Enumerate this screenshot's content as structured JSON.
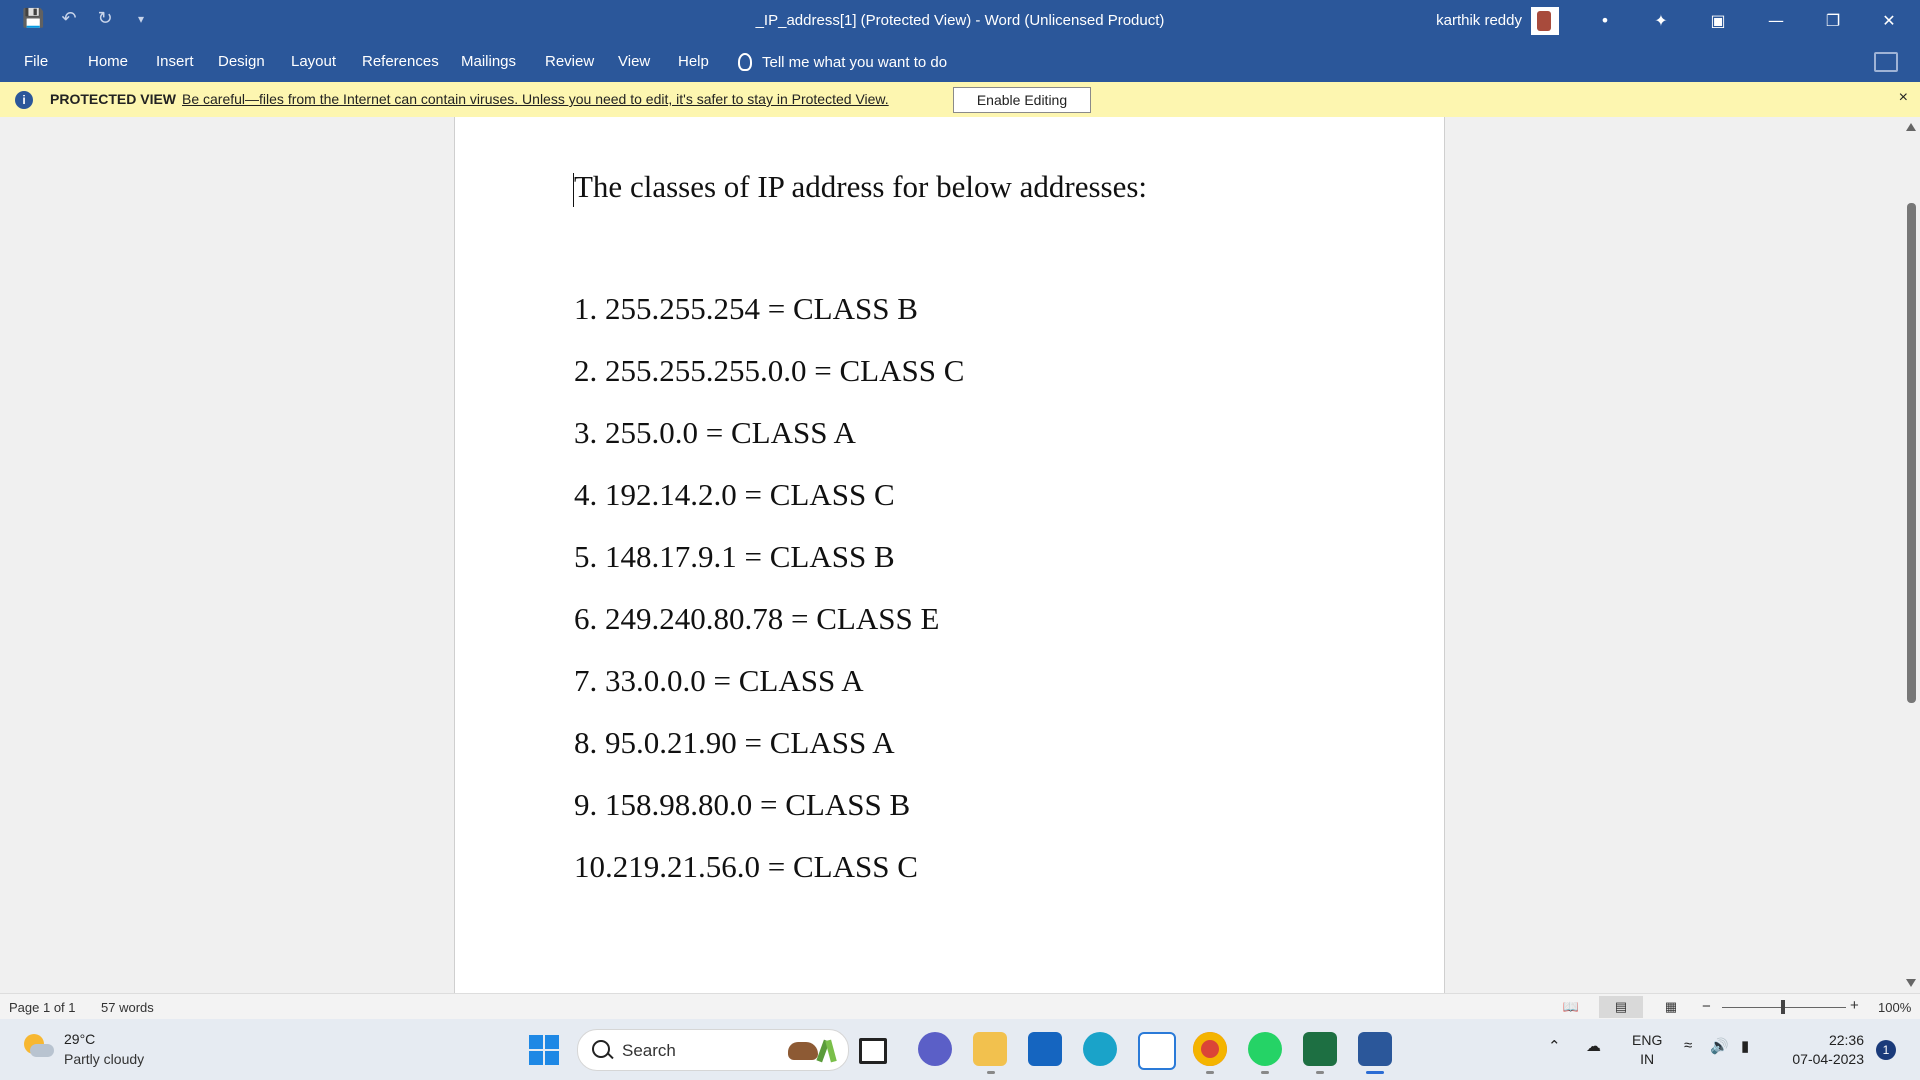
{
  "window": {
    "title": "_IP_address[1] (Protected View)  -  Word (Unlicensed Product)",
    "user": "karthik reddy"
  },
  "qat": {
    "icons": [
      "save-icon",
      "undo-icon",
      "redo-icon",
      "customize-icon"
    ]
  },
  "ribbon": {
    "tabs": [
      "File",
      "Home",
      "Insert",
      "Design",
      "Layout",
      "References",
      "Mailings",
      "Review",
      "View",
      "Help"
    ],
    "tell_me": "Tell me what you want to do"
  },
  "protected_view": {
    "label": "PROTECTED VIEW",
    "message": "Be careful—files from the Internet can contain viruses. Unless you need to edit, it's safer to stay in Protected View.",
    "button": "Enable Editing",
    "close": "×"
  },
  "document": {
    "heading": "The classes of IP address for below addresses:",
    "items": [
      "1.  255.255.254  =  CLASS B",
      "2.  255.255.255.0.0 = CLASS C",
      "3.  255.0.0 = CLASS A",
      "4.  192.14.2.0 = CLASS C",
      "5.  148.17.9.1 = CLASS B",
      "6.  249.240.80.78 = CLASS E",
      "7.  33.0.0.0 = CLASS A",
      "8. 95.0.21.90 = CLASS A",
      "9.  158.98.80.0 = CLASS B",
      "10.219.21.56.0 = CLASS C"
    ]
  },
  "status": {
    "page": "Page 1 of 1",
    "words": "57 words",
    "zoom": "100%",
    "zoom_minus": "−",
    "zoom_plus": "+"
  },
  "taskbar": {
    "weather_temp": "29°C",
    "weather_cond": "Partly cloudy",
    "search": "Search",
    "lang_line1": "ENG",
    "lang_line2": "IN",
    "time": "22:36",
    "date": "07-04-2023",
    "notifications": "1"
  },
  "colors": {
    "word_blue": "#2b579a",
    "protected_bar": "#fdf6b0",
    "excel_green": "#1d6f42",
    "whatsapp_green": "#25d366"
  }
}
